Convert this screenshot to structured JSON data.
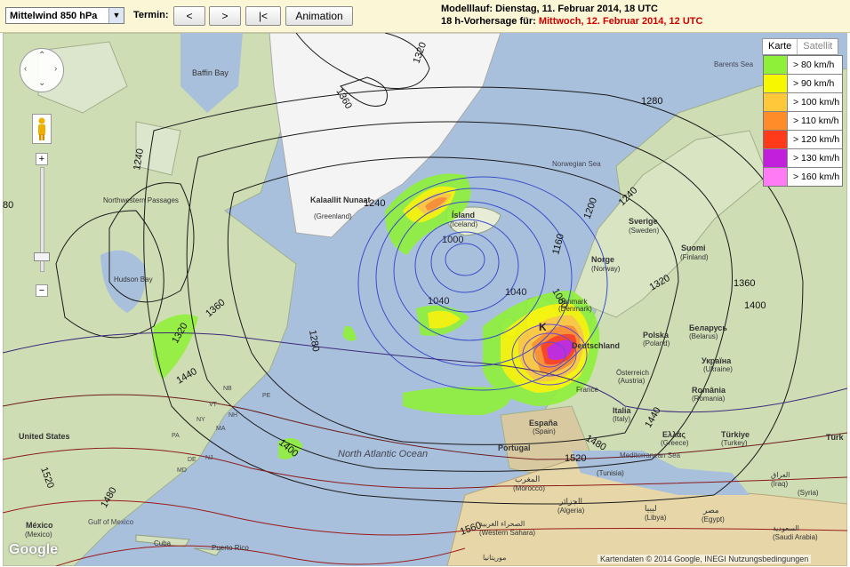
{
  "toolbar": {
    "product_select": "Mittelwind 850 hPa",
    "termin_label": "Termin:",
    "btn_prev": "<",
    "btn_next": ">",
    "btn_first": "|<",
    "btn_animation": "Animation"
  },
  "run_info": {
    "line1": "Modelllauf: Dienstag, 11. Februar 2014, 18 UTC",
    "line2_prefix": "18 h-Vorhersage für: ",
    "line2_value": "Mittwoch, 12. Februar 2014, 12 UTC"
  },
  "map_type_tabs": [
    "Karte",
    "Satellit"
  ],
  "legend": [
    {
      "label": "> 80 km/h",
      "color": "#8ff03a"
    },
    {
      "label": "> 90 km/h",
      "color": "#f7f700"
    },
    {
      "label": "> 100 km/h",
      "color": "#ffc83a"
    },
    {
      "label": "> 110 km/h",
      "color": "#ff8c28"
    },
    {
      "label": "> 120 km/h",
      "color": "#ff3a1a"
    },
    {
      "label": "> 130 km/h",
      "color": "#c21fdc"
    },
    {
      "label": "> 160 km/h",
      "color": "#ff7af5"
    }
  ],
  "map_labels": {
    "baffin_bay": "Baffin Bay",
    "kalaallit": "Kalaallit Nunaat",
    "greenland": "(Greenland)",
    "norwegian_sea": "Norwegian Sea",
    "barents_sea": "Barents Sea",
    "island": "Ísland",
    "iceland": "(Iceland)",
    "northwestern_passages": "Northwestern Passages",
    "hudson_bay": "Hudson Bay",
    "sverige": "Sverige",
    "sweden": "(Sweden)",
    "suomi": "Suomi",
    "finland": "(Finland)",
    "norge": "Norge",
    "norway": "(Norway)",
    "deutschland": "Deutschland",
    "polska": "Polska",
    "poland": "(Poland)",
    "belarus": "Беларусь",
    "belarus_en": "(Belarus)",
    "ukraine": "Україна",
    "ukraine_en": "(Ukraine)",
    "osterreich": "Österreich",
    "austria": "(Austria)",
    "romania": "România",
    "romania_en": "(Romania)",
    "italia": "Italia",
    "italy": "(Italy)",
    "espana": "España",
    "spain": "(Spain)",
    "portugal": "Portugal",
    "ellas": "Ελλάς",
    "greece": "(Greece)",
    "turkey": "Türkiye",
    "turkey_en": "(Turkey)",
    "turk": "Türk",
    "mediterranean": "Mediterranean Sea",
    "united_states": "United States",
    "north_atlantic": "North Atlantic Ocean",
    "gulf_mexico": "Gulf of Mexico",
    "mexico": "México",
    "mexico_en": "(Mexico)",
    "cuba": "Cuba",
    "puerto_rico": "Puerto Rico",
    "morocco_ar": "المغرب",
    "morocco": "(Morocco)",
    "algeria_ar": "الجزائر",
    "algeria": "(Algeria)",
    "tunisia": "(Tunisia)",
    "libya_ar": "ليبيا",
    "libya": "(Libya)",
    "egypt_ar": "مصر",
    "egypt": "(Egypt)",
    "western_sahara_ar": "الصحراء الغربية",
    "western_sahara": "(Western Sahara)",
    "mauritania_ar": "موريتانيا",
    "iraq": "(Iraq)",
    "saudi_ar": "السعودية",
    "saudi": "(Saudi Arabia)",
    "iraq_ar": "العراق",
    "syria": "(Syria)",
    "ireland": "Ireland",
    "danmark": "Danmark",
    "denmark": "(Denmark)",
    "france": "France",
    "uk": "UK"
  },
  "contours": [
    {
      "value": "1320",
      "label": "1320"
    },
    {
      "value": "1360",
      "label": "1360"
    },
    {
      "value": "1240",
      "label": "1240"
    },
    {
      "value": "1280",
      "label": "1280"
    },
    {
      "value": "1200",
      "label": "1200"
    },
    {
      "value": "1160",
      "label": "1160"
    },
    {
      "value": "1000",
      "label": "1000"
    },
    {
      "value": "1040",
      "label": "1040"
    },
    {
      "value": "1080",
      "label": "1080"
    },
    {
      "value": "1400",
      "label": "1400"
    },
    {
      "value": "1440",
      "label": "1440"
    },
    {
      "value": "1480",
      "label": "1480"
    },
    {
      "value": "1520",
      "label": "1520"
    },
    {
      "value": "1560",
      "label": "1560"
    },
    {
      "value": "1280-edge",
      "label": "80"
    }
  ],
  "us_states": [
    "NB",
    "PE",
    "VT",
    "NH",
    "MA",
    "NJ",
    "DE",
    "MD",
    "NY",
    "PA"
  ],
  "low_center": "K",
  "google_logo": "Google",
  "attribution": "Kartendaten © 2014 Google, INEGI   Nutzungsbedingungen",
  "map_controls": {
    "zoom_in": "+",
    "zoom_out": "−",
    "pan_up": "⌃",
    "pan_down": "⌄",
    "pan_left": "‹",
    "pan_right": "›"
  }
}
